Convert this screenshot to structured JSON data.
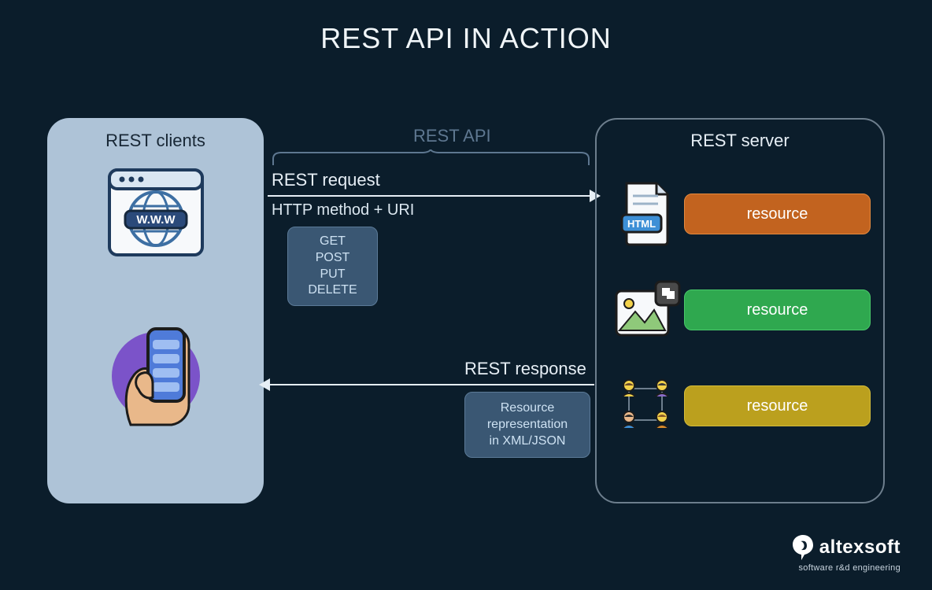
{
  "title": "REST API IN ACTION",
  "clients": {
    "title": "REST clients",
    "www_label": "W.W.W"
  },
  "api": {
    "label": "REST API",
    "request_label": "REST request",
    "request_sub": "HTTP method + URI",
    "methods": [
      "GET",
      "POST",
      "PUT",
      "DELETE"
    ],
    "response_label": "REST response",
    "response_box": [
      "Resource",
      "representation",
      "in XML/JSON"
    ]
  },
  "server": {
    "title": "REST server",
    "resources": [
      {
        "label": "resource",
        "color": "orange",
        "icon": "html-file"
      },
      {
        "label": "resource",
        "color": "green",
        "icon": "image-file"
      },
      {
        "label": "resource",
        "color": "olive",
        "icon": "people-graph"
      }
    ],
    "html_badge": "HTML"
  },
  "brand": {
    "name": "altexsoft",
    "tagline": "software r&d engineering"
  }
}
